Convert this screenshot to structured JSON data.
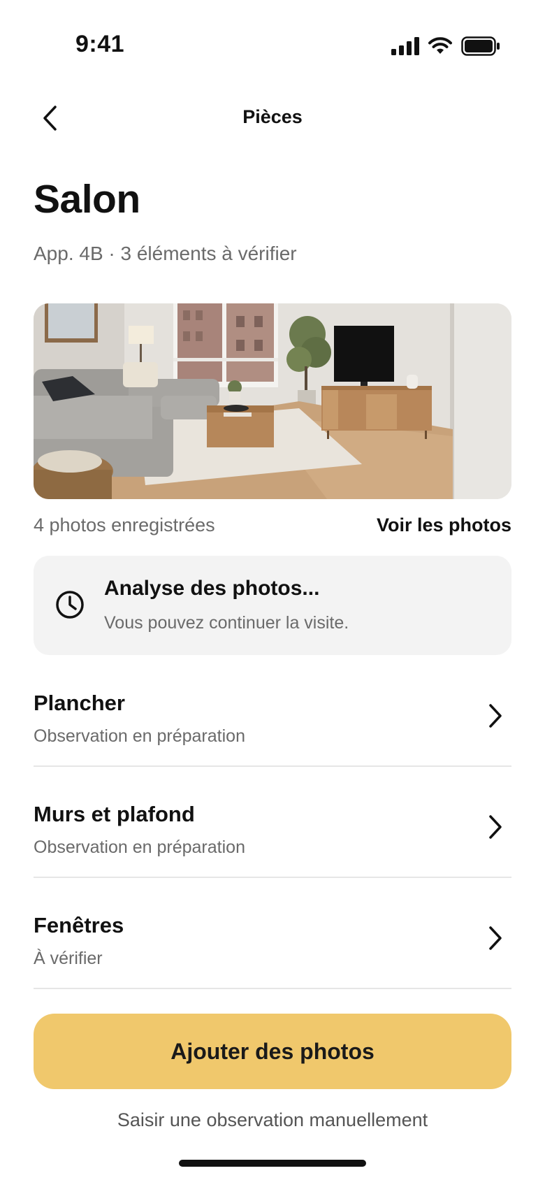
{
  "status_bar": {
    "time": "9:41"
  },
  "nav": {
    "title": "Pièces"
  },
  "room": {
    "title": "Salon",
    "subtitle": "App. 4B · 3 éléments à vérifier"
  },
  "photos": {
    "count_label": "4 photos enregistrées",
    "view_link": "Voir les photos"
  },
  "analysis_card": {
    "title": "Analyse des photos...",
    "text": "Vous pouvez continuer la visite."
  },
  "items": [
    {
      "title": "Plancher",
      "status": "Observation en préparation"
    },
    {
      "title": "Murs et plafond",
      "status": "Observation en préparation"
    },
    {
      "title": "Fenêtres",
      "status": "À vérifier"
    }
  ],
  "actions": {
    "primary": "Ajouter des photos",
    "secondary": "Saisir une observation manuellement"
  },
  "colors": {
    "accent": "#f0c86c",
    "card_bg": "#f3f3f3",
    "muted_text": "#6a6a6a"
  }
}
